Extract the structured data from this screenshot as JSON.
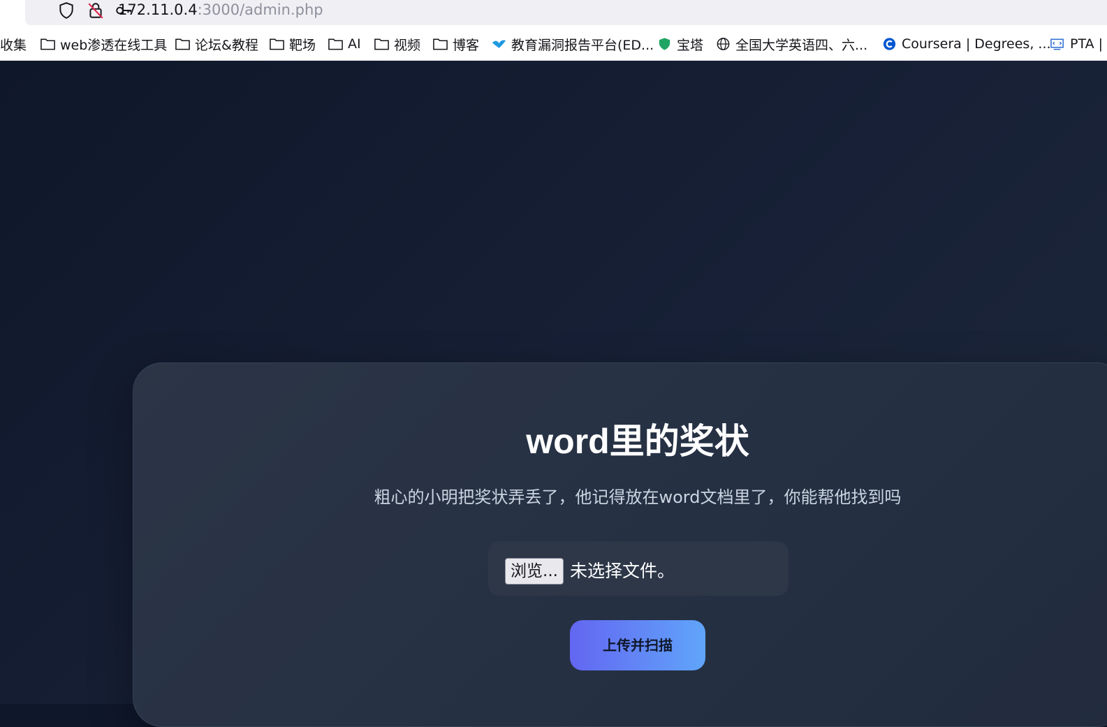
{
  "browser": {
    "url_host": "172.11.0.4",
    "url_rest": ":3000/admin.php"
  },
  "bookmarks": [
    {
      "label": "收集",
      "icon": "none"
    },
    {
      "label": "web渗透在线工具",
      "icon": "folder-icon"
    },
    {
      "label": "论坛&教程",
      "icon": "folder-icon"
    },
    {
      "label": "靶场",
      "icon": "folder-icon"
    },
    {
      "label": "AI",
      "icon": "folder-icon"
    },
    {
      "label": "视频",
      "icon": "folder-icon"
    },
    {
      "label": "博客",
      "icon": "folder-icon"
    },
    {
      "label": "教育漏洞报告平台(ED...",
      "icon": "bird-icon"
    },
    {
      "label": "宝塔",
      "icon": "shield-icon"
    },
    {
      "label": "全国大学英语四、六...",
      "icon": "globe-icon"
    },
    {
      "label": "Coursera | Degrees, ...",
      "icon": "coursera-icon"
    },
    {
      "label": "PTA | ",
      "icon": "pta-icon"
    }
  ],
  "main": {
    "title": "word里的奖状",
    "subtitle": "粗心的小明把奖状弄丢了，他记得放在word文档里了，你能帮他找到吗",
    "file_button_label": "浏览...",
    "file_status": "未选择文件。",
    "submit_label": "上传并扫描"
  },
  "colors": {
    "background": "#0f172a",
    "card": "#283244",
    "accent_start": "#6366f1",
    "accent_end": "#60a5fa"
  }
}
